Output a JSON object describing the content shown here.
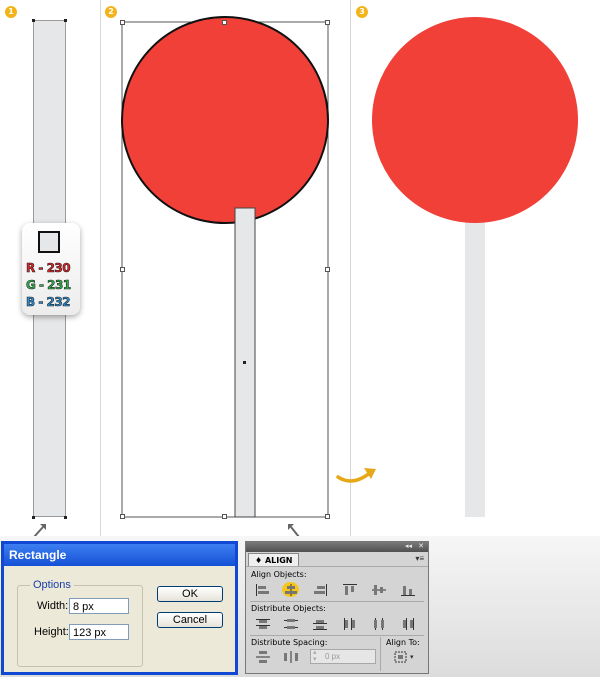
{
  "steps": [
    "1",
    "2",
    "3"
  ],
  "color_card": {
    "r_text": "R - 230",
    "g_text": "G - 231",
    "b_text": "B - 232",
    "stick_color": "#e6e7e8"
  },
  "colors": {
    "candy": "#f04038",
    "stick": "#e6e7e8",
    "badge": "#f3b41a",
    "arrow": "#e6a817",
    "dialog_blue": "#1450d6"
  },
  "rectangle_dialog": {
    "title": "Rectangle",
    "options_label": "Options",
    "width_label": "Width:",
    "width_value": "8 px",
    "height_label": "Height:",
    "height_value": "123 px",
    "ok_label": "OK",
    "cancel_label": "Cancel"
  },
  "align_panel": {
    "tab_label": "♦ ALIGN",
    "align_objects_label": "Align Objects:",
    "distribute_objects_label": "Distribute Objects:",
    "distribute_spacing_label": "Distribute Spacing:",
    "align_to_label": "Align To:",
    "spacing_value": "0 px",
    "align_icons": [
      "horizontal-align-left-icon",
      "horizontal-align-center-icon",
      "horizontal-align-right-icon",
      "vertical-align-top-icon",
      "vertical-align-center-icon",
      "vertical-align-bottom-icon"
    ],
    "distribute_icons": [
      "vertical-distribute-top-icon",
      "vertical-distribute-center-icon",
      "vertical-distribute-bottom-icon",
      "horizontal-distribute-left-icon",
      "horizontal-distribute-center-icon",
      "horizontal-distribute-right-icon"
    ],
    "active_align": "horizontal-align-center-icon"
  }
}
